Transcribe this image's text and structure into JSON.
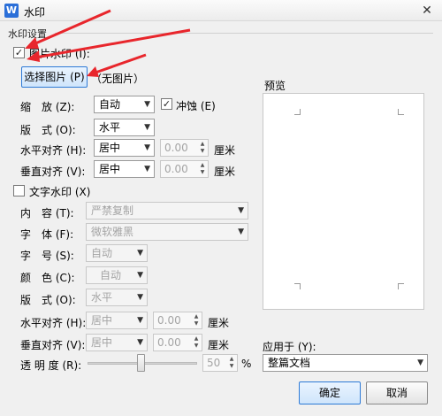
{
  "window": {
    "title": "水印",
    "close_glyph": "✕"
  },
  "group_title": "水印设置",
  "picture_watermark": {
    "checkbox_label": "图片水印 (I):",
    "checked": true,
    "select_button": "选择图片 (P)",
    "no_picture": "（无图片）",
    "scale_label": "缩　放 (Z):",
    "scale_value": "自动",
    "washout_label": "冲蚀 (E)",
    "washout_checked": true,
    "layout_label": "版　式 (O):",
    "layout_value": "水平",
    "h_align_label": "水平对齐 (H):",
    "h_align_value": "居中",
    "h_offset": "0.00",
    "v_align_label": "垂直对齐 (V):",
    "v_align_value": "居中",
    "v_offset": "0.00",
    "unit": "厘米"
  },
  "text_watermark": {
    "checkbox_label": "文字水印 (X)",
    "checked": false,
    "content_label": "内　容 (T):",
    "content_value": "严禁复制",
    "font_label": "字　体 (F):",
    "font_value": "微软雅黑",
    "size_label": "字　号 (S):",
    "size_value": "自动",
    "color_label": "颜　色 (C):",
    "color_value": "自动",
    "layout_label": "版　式 (O):",
    "layout_value": "水平",
    "h_align_label": "水平对齐 (H):",
    "h_align_value": "居中",
    "h_offset": "0.00",
    "v_align_label": "垂直对齐 (V):",
    "v_align_value": "居中",
    "v_offset": "0.00",
    "unit": "厘米",
    "transparency_label": "透 明 度 (R):",
    "transparency_value": "50",
    "percent": "%"
  },
  "preview": {
    "label": "预览"
  },
  "apply_to": {
    "label": "应用于 (Y):",
    "value": "整篇文档"
  },
  "buttons": {
    "ok": "确定",
    "cancel": "取消"
  },
  "colors": {
    "accent": "#2d7ad6",
    "annotation_arrow": "#e8262c"
  }
}
